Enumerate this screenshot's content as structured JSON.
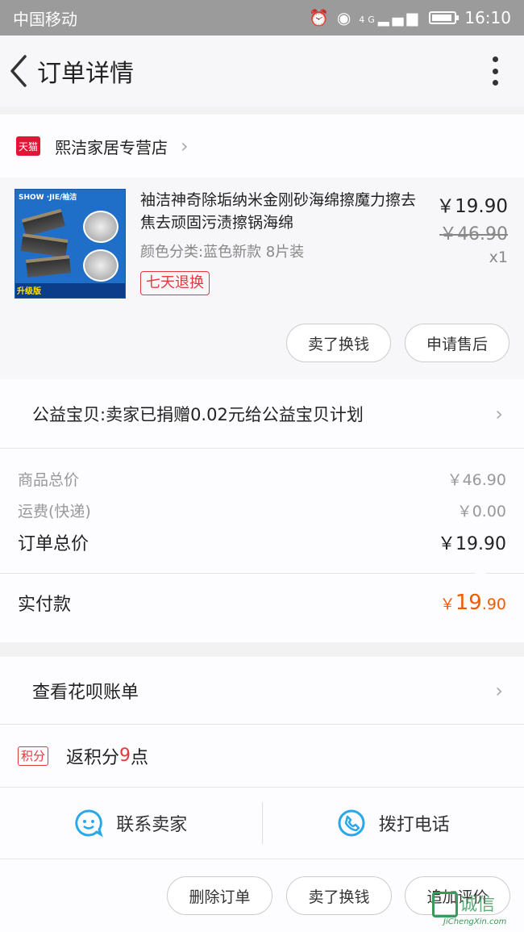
{
  "status_bar": {
    "carrier": "中国移动",
    "signal_label": "4G",
    "time": "16:10"
  },
  "nav": {
    "title": "订单详情"
  },
  "shop": {
    "badge": "天猫",
    "name": "熙洁家居专营店"
  },
  "product": {
    "image_label": "SHOW ·JIE/袖洁",
    "image_upgrade": "升级版",
    "title": "袖洁神奇除垢纳米金刚砂海绵擦魔力擦去焦去顽固污渍擦锅海绵",
    "spec": "颜色分类:蓝色新款 8片装",
    "return_tag": "七天退换",
    "price": "￥19.90",
    "original_price": "￥46.90",
    "quantity": "x1",
    "btn_sell": "卖了换钱",
    "btn_aftersale": "申请售后"
  },
  "donation": {
    "text": "公益宝贝:卖家已捐赠0.02元给公益宝贝计划"
  },
  "summary": {
    "goods_total_label": "商品总价",
    "goods_total": "￥46.90",
    "shipping_label": "运费(快递)",
    "shipping": "￥0.00",
    "order_total_label": "订单总价",
    "order_total": "￥19.90",
    "paid_label": "实付款",
    "paid_symbol": "￥",
    "paid_int": "19",
    "paid_dec": ".90"
  },
  "huabei": {
    "label": "查看花呗账单"
  },
  "points": {
    "tag": "积分",
    "prefix": "返积分",
    "value": "9",
    "suffix": "点"
  },
  "contact": {
    "seller": "联系卖家",
    "phone": "拨打电话"
  },
  "actions": {
    "delete": "删除订单",
    "sell": "卖了换钱",
    "review": "追加评价"
  },
  "watermark": {
    "main": "诚信",
    "sub": "JiChengXin.com"
  },
  "colors": {
    "accent": "#e4393c",
    "paid": "#f55a00",
    "icon_blue": "#2aa7e8"
  }
}
